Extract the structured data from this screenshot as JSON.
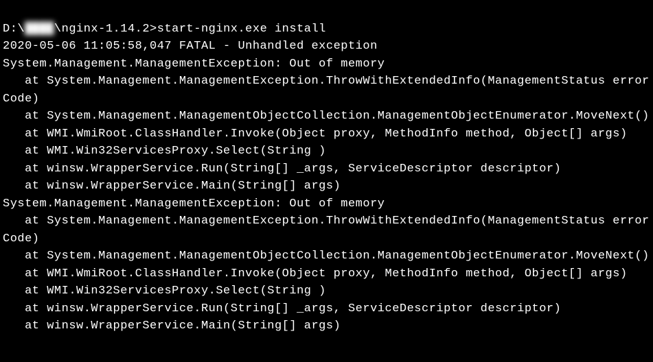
{
  "terminal": {
    "prompt_drive": "D:\\",
    "prompt_blurred": "████",
    "prompt_path": "\\nginx-1.14.2>",
    "command": "start-nginx.exe install",
    "lines": [
      "2020-05-06 11:05:58,047 FATAL - Unhandled exception",
      "System.Management.ManagementException: Out of memory",
      "   at System.Management.ManagementException.ThrowWithExtendedInfo(ManagementStatus errorCode)",
      "   at System.Management.ManagementObjectCollection.ManagementObjectEnumerator.MoveNext()",
      "   at WMI.WmiRoot.ClassHandler.Invoke(Object proxy, MethodInfo method, Object[] args)",
      "   at WMI.Win32ServicesProxy.Select(String )",
      "   at winsw.WrapperService.Run(String[] _args, ServiceDescriptor descriptor)",
      "   at winsw.WrapperService.Main(String[] args)",
      "System.Management.ManagementException: Out of memory",
      "   at System.Management.ManagementException.ThrowWithExtendedInfo(ManagementStatus errorCode)",
      "   at System.Management.ManagementObjectCollection.ManagementObjectEnumerator.MoveNext()",
      "   at WMI.WmiRoot.ClassHandler.Invoke(Object proxy, MethodInfo method, Object[] args)",
      "   at WMI.Win32ServicesProxy.Select(String )",
      "   at winsw.WrapperService.Run(String[] _args, ServiceDescriptor descriptor)",
      "   at winsw.WrapperService.Main(String[] args)"
    ]
  }
}
